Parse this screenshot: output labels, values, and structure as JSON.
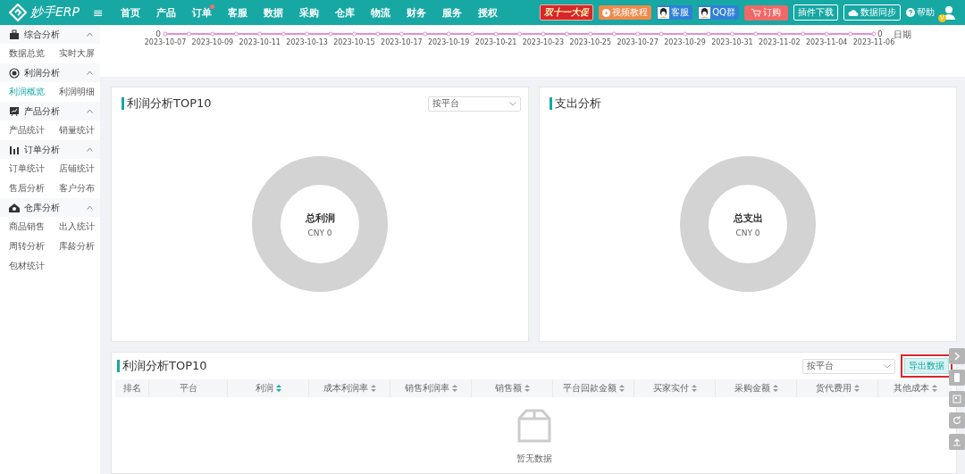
{
  "header": {
    "logo": "妙手ERP",
    "menu_icon": "≡",
    "nav": [
      {
        "label": "首页",
        "badge": false
      },
      {
        "label": "产品",
        "badge": false
      },
      {
        "label": "订单",
        "badge": true
      },
      {
        "label": "客服",
        "badge": false
      },
      {
        "label": "数据",
        "badge": false
      },
      {
        "label": "采购",
        "badge": false
      },
      {
        "label": "仓库",
        "badge": false
      },
      {
        "label": "物流",
        "badge": false
      },
      {
        "label": "财务",
        "badge": false
      },
      {
        "label": "服务",
        "badge": false
      },
      {
        "label": "授权",
        "badge": false
      }
    ],
    "actions": [
      {
        "kind": "promo",
        "label": "双十一大促"
      },
      {
        "kind": "video",
        "label": "视频教程"
      },
      {
        "kind": "qq",
        "label": "客服"
      },
      {
        "kind": "qq",
        "label": "QQ群"
      },
      {
        "kind": "cart",
        "label": "订购"
      },
      {
        "kind": "outline",
        "label": "插件下载"
      },
      {
        "kind": "cloud",
        "label": "数据同步"
      },
      {
        "kind": "help",
        "label": "帮助"
      }
    ],
    "avatar_badge": "V"
  },
  "sidebar": {
    "groups": [
      {
        "title": "综合分析",
        "expanded": true,
        "items": [
          {
            "label": "数据总览",
            "selected": false
          },
          {
            "label": "实时大屏",
            "selected": false
          }
        ]
      },
      {
        "title": "利润分析",
        "expanded": true,
        "items": [
          {
            "label": "利润概览",
            "selected": true
          },
          {
            "label": "利润明细",
            "selected": false
          }
        ]
      },
      {
        "title": "产品分析",
        "expanded": true,
        "items": [
          {
            "label": "产品统计",
            "selected": false
          },
          {
            "label": "销量统计",
            "selected": false
          }
        ]
      },
      {
        "title": "订单分析",
        "expanded": true,
        "items": [
          {
            "label": "订单统计",
            "selected": false
          },
          {
            "label": "店铺统计",
            "selected": false
          },
          {
            "label": "售后分析",
            "selected": false
          },
          {
            "label": "客户分布",
            "selected": false
          }
        ]
      },
      {
        "title": "仓库分析",
        "expanded": true,
        "items": [
          {
            "label": "商品销售",
            "selected": false
          },
          {
            "label": "出入统计",
            "selected": false
          },
          {
            "label": "周转分析",
            "selected": false
          },
          {
            "label": "库龄分析",
            "selected": false
          },
          {
            "label": "包材统计",
            "selected": false
          }
        ]
      }
    ]
  },
  "trend_chart": {
    "xlabel": "日期",
    "dates": [
      "2023-10-07",
      "2023-10-09",
      "2023-10-11",
      "2023-10-13",
      "2023-10-15",
      "2023-10-17",
      "2023-10-19",
      "2023-10-21",
      "2023-10-23",
      "2023-10-25",
      "2023-10-27",
      "2023-10-29",
      "2023-10-31",
      "2023-11-02",
      "2023-11-04",
      "2023-11-06"
    ],
    "left_axis_tick": "0",
    "right_axis_tick": "0"
  },
  "cards": [
    {
      "title": "利润分析TOP10",
      "select": "按平台",
      "center_title": "总利润",
      "center_value": "CNY 0"
    },
    {
      "title": "支出分析",
      "center_title": "总支出",
      "center_value": "CNY 0"
    }
  ],
  "table": {
    "title": "利润分析TOP10",
    "select": "按平台",
    "export_button": "导出数据",
    "export_highlighted": true,
    "columns": [
      {
        "label": "排名",
        "sortable": false
      },
      {
        "label": "平台",
        "sortable": false
      },
      {
        "label": "利润",
        "sortable": true,
        "sorted": true
      },
      {
        "label": "成本利润率",
        "sortable": true,
        "sorted": false
      },
      {
        "label": "销售利润率",
        "sortable": true,
        "sorted": false
      },
      {
        "label": "销售额",
        "sortable": true,
        "sorted": false
      },
      {
        "label": "平台回款金额",
        "sortable": true,
        "sorted": false
      },
      {
        "label": "买家实付",
        "sortable": true,
        "sorted": false
      },
      {
        "label": "采购金额",
        "sortable": true,
        "sorted": false
      },
      {
        "label": "货代费用",
        "sortable": true,
        "sorted": false
      },
      {
        "label": "其他成本",
        "sortable": true,
        "sorted": false
      }
    ],
    "empty_text": "暂无数据"
  }
}
